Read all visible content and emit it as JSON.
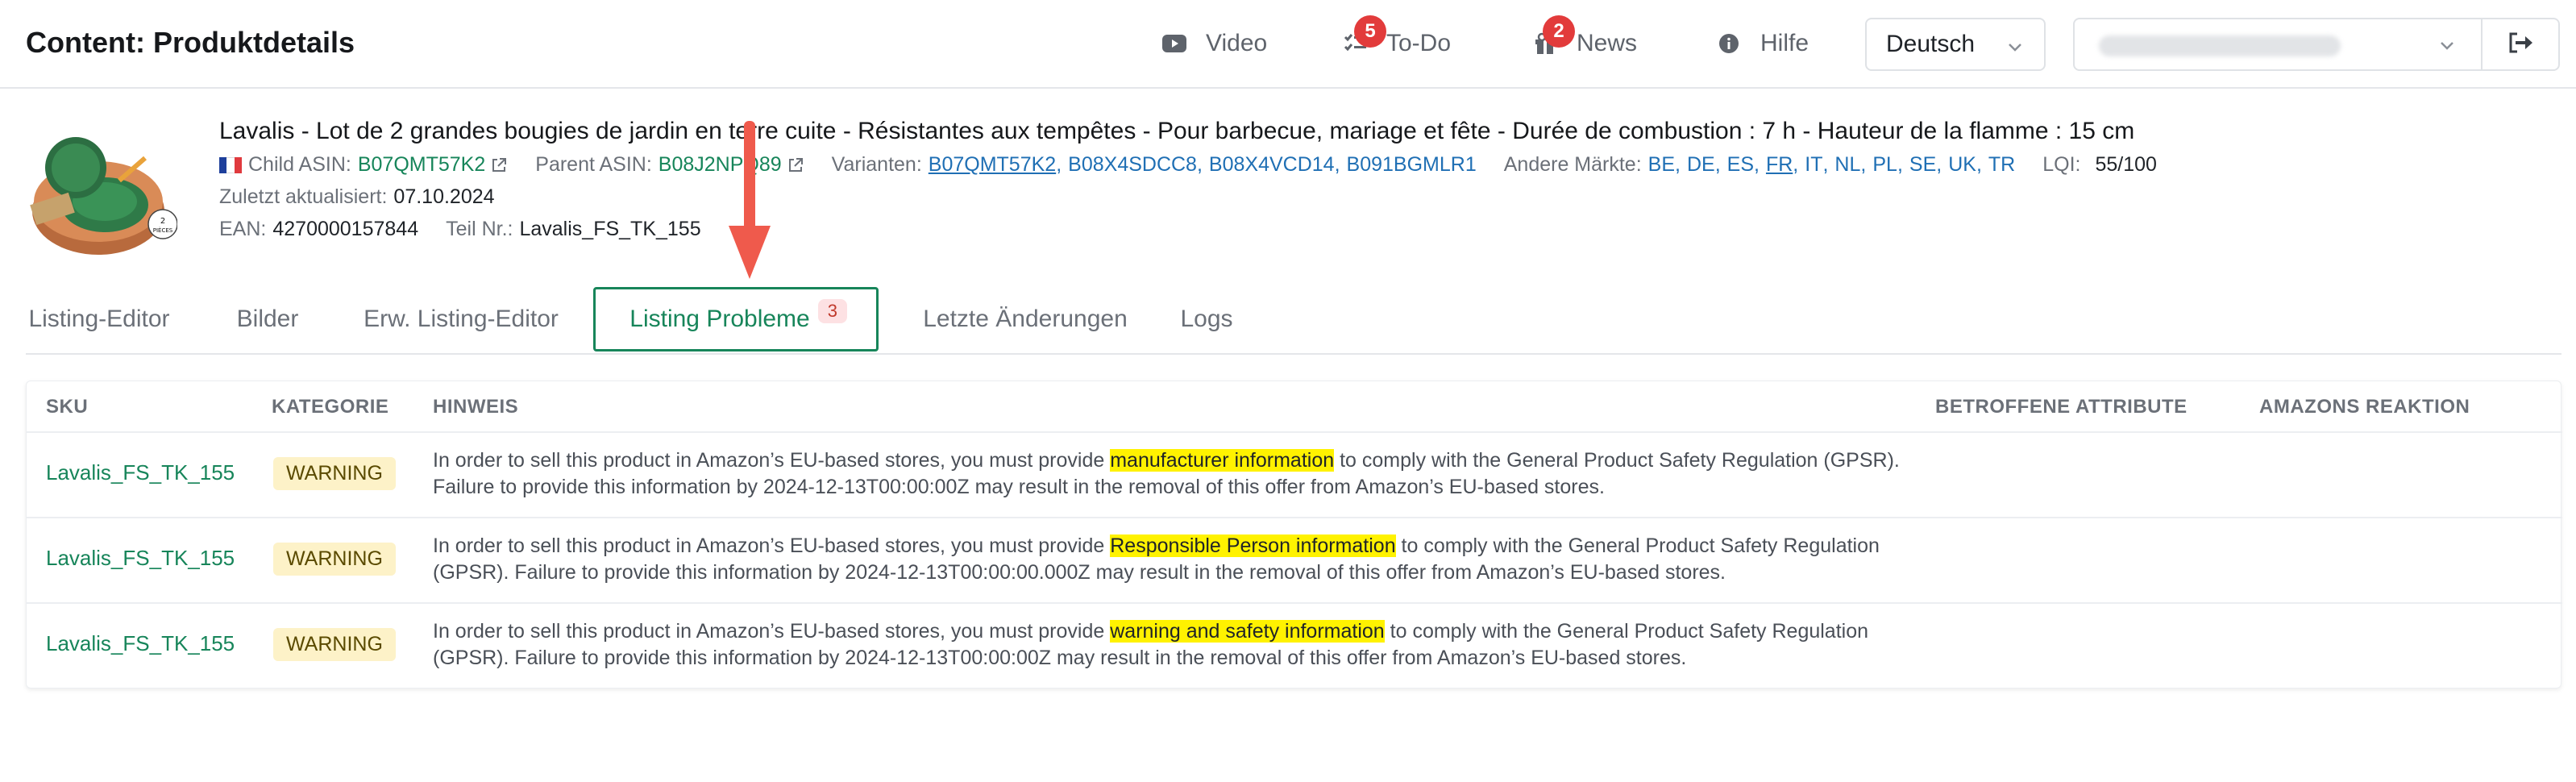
{
  "header": {
    "title": "Content: Produktdetails",
    "nav": {
      "video": "Video",
      "todo": "To-Do",
      "todo_badge": "5",
      "news": "News",
      "news_badge": "2",
      "help": "Hilfe"
    },
    "language": "Deutsch"
  },
  "product": {
    "title": "Lavalis - Lot de 2 grandes bougies de jardin en terre cuite - Résistantes aux tempêtes - Pour barbecue, mariage et fête - Durée de combustion : 7 h - Hauteur de la flamme : 15 cm",
    "child_asin_label": "Child ASIN:",
    "child_asin": "B07QMT57K2",
    "parent_asin_label": "Parent ASIN:",
    "parent_asin": "B08J2NPQ89",
    "variants_label": "Varianten:",
    "variants": [
      "B07QMT57K2",
      "B08X4SDCC8",
      "B08X4VCD14",
      "B091BGMLR1"
    ],
    "markets_label": "Andere Märkte:",
    "markets": [
      "BE",
      "DE",
      "ES",
      "FR",
      "IT",
      "NL",
      "PL",
      "SE",
      "UK",
      "TR"
    ],
    "lqi_label": "LQI:",
    "lqi": "55/100",
    "updated_label": "Zuletzt aktualisiert:",
    "updated": "07.10.2024",
    "ean_label": "EAN:",
    "ean": "4270000157844",
    "part_label": "Teil Nr.:",
    "part": "Lavalis_FS_TK_155",
    "image_badge": "2 PIÈCES"
  },
  "tabs": [
    {
      "label": "Listing-Editor"
    },
    {
      "label": "Bilder"
    },
    {
      "label": "Erw. Listing-Editor"
    },
    {
      "label": "Listing Probleme",
      "badge": "3"
    },
    {
      "label": "Letzte Änderungen"
    },
    {
      "label": "Logs"
    }
  ],
  "table": {
    "headers": {
      "sku": "SKU",
      "category": "KATEGORIE",
      "hint": "HINWEIS",
      "attributes": "BETROFFENE ATTRIBUTE",
      "reaction": "AMAZONS REAKTION"
    },
    "rows": [
      {
        "sku": "Lavalis_FS_TK_155",
        "category": "WARNING",
        "hint_pre": "In order to sell this product in Amazon’s EU-based stores, you must provide ",
        "hint_hl": "manufacturer information",
        "hint_post": " to comply with the General Product Safety Regulation (GPSR). Failure to provide this information by 2024-12-13T00:00:00Z may result in the removal of this offer from Amazon’s EU-based stores."
      },
      {
        "sku": "Lavalis_FS_TK_155",
        "category": "WARNING",
        "hint_pre": "In order to sell this product in Amazon’s EU-based stores, you must provide ",
        "hint_hl": "Responsible Person information",
        "hint_post": " to comply with the General Product Safety Regulation (GPSR). Failure to provide this information by 2024-12-13T00:00:00.000Z may result in the removal of this offer from Amazon’s EU-based stores."
      },
      {
        "sku": "Lavalis_FS_TK_155",
        "category": "WARNING",
        "hint_pre": "In order to sell this product in Amazon’s EU-based stores, you must provide ",
        "hint_hl": "warning and safety information",
        "hint_post": " to comply with the General Product Safety Regulation (GPSR). Failure to provide this information by 2024-12-13T00:00:00Z may result in the removal of this offer from Amazon’s EU-based stores."
      }
    ]
  },
  "colors": {
    "accent_green": "#17855a",
    "badge_red": "#e23b3b",
    "warning_bg": "#fdf2c8",
    "highlight": "#fff200",
    "arrow": "#ef5a4c"
  }
}
